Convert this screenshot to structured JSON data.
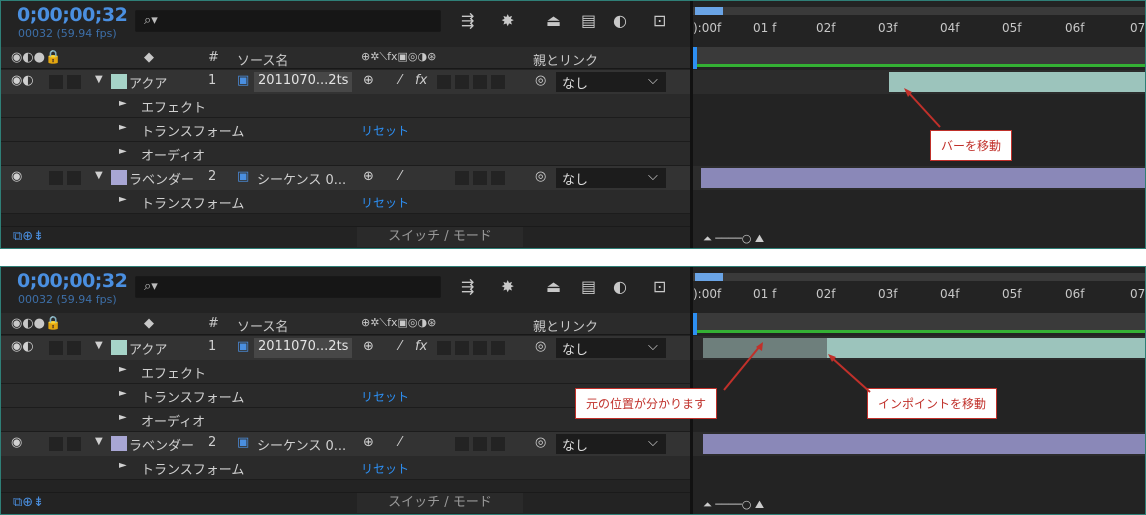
{
  "timecode": "0;00;00;32",
  "fps": "00032 (59.94 fps)",
  "headers": {
    "col_hash": "#",
    "source": "ソース名",
    "parent": "親とリンク"
  },
  "layers": [
    {
      "name": "アクア",
      "num": "1",
      "source": "2011070...2ts",
      "parent": "なし",
      "color": "#a6d4c8"
    },
    {
      "name": "ラベンダー",
      "num": "2",
      "source": "シーケンス 0...",
      "parent": "なし",
      "color": "#a8a6d4"
    }
  ],
  "props": {
    "effect": "エフェクト",
    "transform": "トランスフォーム",
    "audio": "オーディオ",
    "reset": "リセット"
  },
  "switch_mode": "スイッチ / モード",
  "ruler": [
    "):00f",
    "01 f",
    "02f",
    "03f",
    "04f",
    "05f",
    "06f",
    "07"
  ],
  "callouts": {
    "move_bar": "バーを移動",
    "original_pos": "元の位置が分かります",
    "move_inpoint": "インポイントを移動"
  },
  "colors": {
    "timecode": "#4a8fe0",
    "accent": "#2d8ff3",
    "callout": "#c0302a",
    "aqua": "#a6d4c8",
    "lavender": "#8a88b8"
  }
}
